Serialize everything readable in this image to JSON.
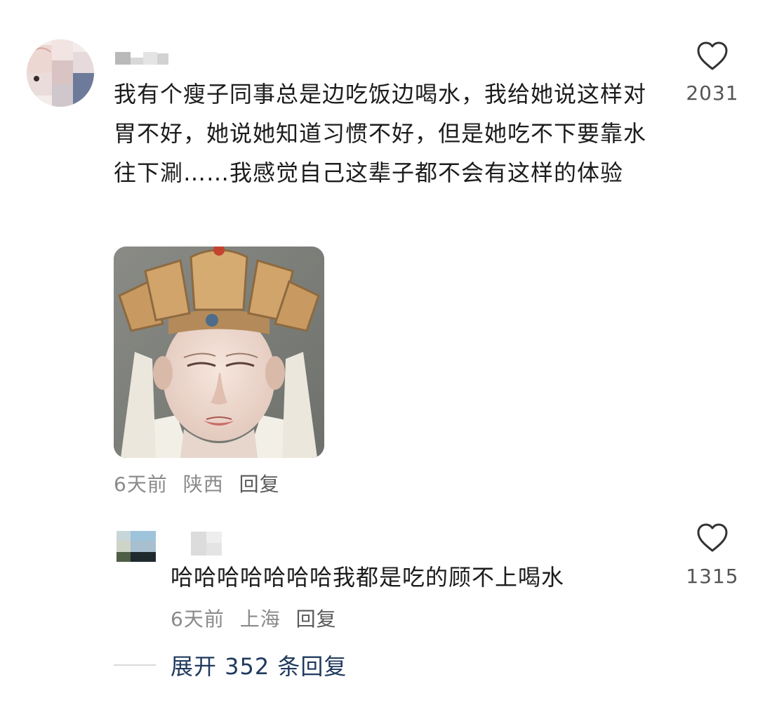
{
  "main_comment": {
    "username": "",
    "text": "我有个瘦子同事总是边吃饭边喝水，我给她说这样对胃不好，她说她知道习惯不好，但是她吃不下要靠水往下涮……我感觉自己这辈子都不会有这样的体验",
    "likes": "2031",
    "time": "6天前",
    "location": "陕西",
    "reply_label": "回复",
    "image_icon": "bodhisattva-statue-meme",
    "heart_icon": "heart-outline-icon"
  },
  "reply": {
    "username": "",
    "text": "哈哈哈哈哈哈哈我都是吃的顾不上喝水",
    "likes": "1315",
    "time": "6天前",
    "location": "上海",
    "reply_label": "回复",
    "heart_icon": "heart-outline-icon"
  },
  "expand": {
    "label": "展开 352 条回复"
  },
  "colors": {
    "text": "#1c1c1c",
    "meta": "#8a8a8a",
    "link": "#203a5e",
    "likes": "#555555"
  }
}
